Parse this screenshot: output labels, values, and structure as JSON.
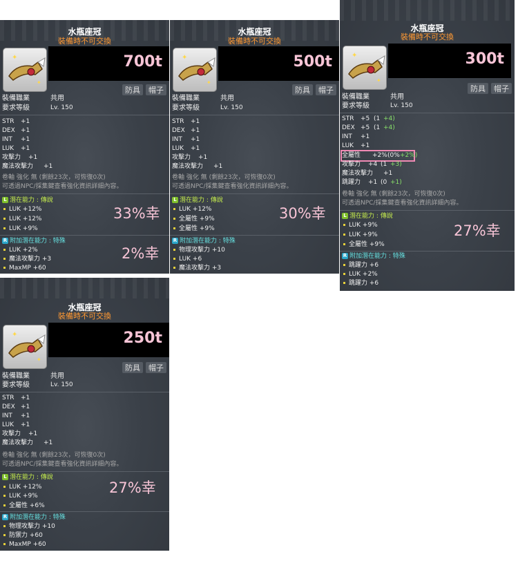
{
  "common": {
    "item_name": "水瓶座冠",
    "trade_note": "裝備時不可交換",
    "tag_armor": "防具",
    "tag_hat": "帽子",
    "job_label": "裝備職業",
    "job_value": "共用",
    "level_label": "要求等級",
    "level_value": "Lv. 150",
    "scroll_line1": "卷軸 強化 無 (剩餘23次，可恢復0次)",
    "scroll_line2": "可透過NPC/採集鍵查看強化資訊詳細內容。",
    "potential_label": "潛在能力 : 傳說",
    "add_potential_label": "附加潛在能力 : 特殊"
  },
  "cards": [
    {
      "price": "700t",
      "stats": [
        {
          "k": "STR",
          "v": "+1"
        },
        {
          "k": "DEX",
          "v": "+1"
        },
        {
          "k": "INT",
          "v": "+1"
        },
        {
          "k": "LUK",
          "v": "+1"
        },
        {
          "k": "攻擊力",
          "v": "+1"
        },
        {
          "k": "魔法攻擊力",
          "v": "+1"
        }
      ],
      "potential": [
        "LUK +12%",
        "LUK +12%",
        "LUK +9%"
      ],
      "add_potential": [
        "LUK +2%",
        "魔法攻擊力 +3",
        "MaxMP +60"
      ],
      "luck_main": "33%幸",
      "luck_add": "2%幸"
    },
    {
      "price": "500t",
      "stats": [
        {
          "k": "STR",
          "v": "+1"
        },
        {
          "k": "DEX",
          "v": "+1"
        },
        {
          "k": "INT",
          "v": "+1"
        },
        {
          "k": "LUK",
          "v": "+1"
        },
        {
          "k": "攻擊力",
          "v": "+1"
        },
        {
          "k": "魔法攻擊力",
          "v": "+1"
        }
      ],
      "potential": [
        "LUK +12%",
        "全屬性 +9%",
        "全屬性 +9%"
      ],
      "add_potential": [
        "物理攻擊力 +10",
        "LUK +6",
        "魔法攻擊力 +3"
      ],
      "luck_main": "30%幸"
    },
    {
      "price": "300t",
      "stats": [
        {
          "k": "STR",
          "v": "+5",
          "base": "(1",
          "bonus": "+4)"
        },
        {
          "k": "DEX",
          "v": "+5",
          "base": "(1",
          "bonus": "+4)"
        },
        {
          "k": "INT",
          "v": "+1"
        },
        {
          "k": "LUK",
          "v": "+1"
        },
        {
          "k": "全屬性",
          "v": "+2%",
          "base": "(0%",
          "bonus": "+2%)"
        },
        {
          "k": "攻擊力",
          "v": "+4",
          "base": "(1",
          "bonus": "+3)"
        },
        {
          "k": "魔法攻擊力",
          "v": "+1"
        },
        {
          "k": "跳躍力",
          "v": "+1",
          "base": "(0",
          "bonus": "+1)"
        }
      ],
      "potential": [
        "LUK +9%",
        "LUK +9%",
        "全屬性 +9%"
      ],
      "add_potential": [
        "跳躍力 +6",
        "LUK +2%",
        "跳躍力 +6"
      ],
      "luck_main": "27%幸"
    },
    {
      "price": "250t",
      "stats": [
        {
          "k": "STR",
          "v": "+1"
        },
        {
          "k": "DEX",
          "v": "+1"
        },
        {
          "k": "INT",
          "v": "+1"
        },
        {
          "k": "LUK",
          "v": "+1"
        },
        {
          "k": "攻擊力",
          "v": "+1"
        },
        {
          "k": "魔法攻擊力",
          "v": "+1"
        }
      ],
      "potential": [
        "LUK +12%",
        "LUK +9%",
        "全屬性 +6%"
      ],
      "add_potential": [
        "物理攻擊力 +10",
        "防禦力 +60",
        "MaxMP +60"
      ],
      "luck_main": "27%幸"
    }
  ],
  "colors": {
    "card_bg": "#3a4048",
    "price": "#f7c4d6",
    "trade_note": "#ff9933",
    "potential": "#c5ec4d",
    "add_potential": "#66e0e0",
    "highlight": "#f08ab4"
  },
  "icons": [
    "crown-item-icon",
    "legendary-badge-icon",
    "rare-badge-icon",
    "bullet-icon"
  ]
}
